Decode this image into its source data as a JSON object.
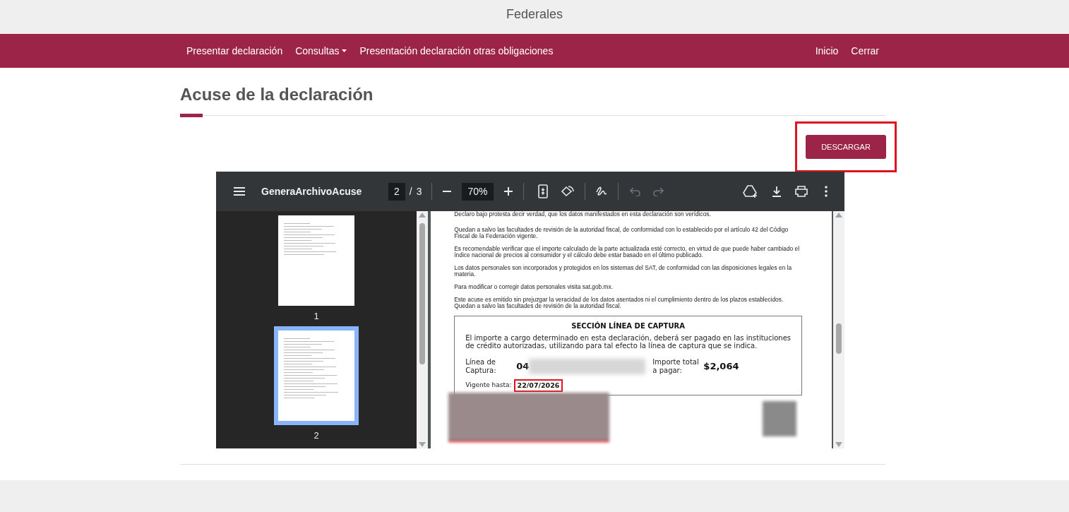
{
  "header": {
    "title": "Federales"
  },
  "nav": {
    "left": [
      {
        "label": "Presentar declaración",
        "kind": "link"
      },
      {
        "label": "Consultas",
        "kind": "dropdown"
      },
      {
        "label": "Presentación declaración otras obligaciones",
        "kind": "link"
      }
    ],
    "right": [
      {
        "label": "Inicio"
      },
      {
        "label": "Cerrar"
      }
    ]
  },
  "page_title": "Acuse de la declaración",
  "download_button": "DESCARGAR",
  "viewer": {
    "file_name": "GeneraArchivoAcuse",
    "page_current": "2",
    "page_separator": "/",
    "page_total": "3",
    "zoom": "70%",
    "thumbnails": [
      {
        "label": "1",
        "selected": false
      },
      {
        "label": "2",
        "selected": true
      }
    ],
    "paragraphs": [
      "Declaro bajo protesta decir verdad, que los datos manifestados en esta declaración son verídicos.",
      "Quedan a salvo las facultades de revisión de la autoridad fiscal, de conformidad con lo establecido por el artículo 42 del Código Fiscal de la Federación vigente.",
      "Es recomendable verificar que el importe calculado de la parte actualizada esté correcto, en virtud de que puede haber cambiado el índice nacional de precios al consumidor y el cálculo debe estar basado en el último publicado.",
      "Los datos personales son incorporados y protegidos en los sistemas del SAT, de conformidad con las disposiciones legales en la materia.",
      "Para modificar o corregir datos personales visita sat.gob.mx.",
      "Este acuse es emitido sin prejuzgar la veracidad de los datos asentados ni el cumplimiento dentro de los plazos establecidos. Quedan a salvo las facultades de revisión de la autoridad fiscal."
    ],
    "section": {
      "title": "SECCIÓN LÍNEA DE CAPTURA",
      "text": "El importe a cargo determinado en esta declaración, deberá ser pagado en las instituciones de crédito autorizadas, utilizando para tal efecto la línea de captura que se indica.",
      "capture_label": "Línea de Captura:",
      "capture_value": "04",
      "total_label": "Importe total a pagar:",
      "total_value": "$2,064",
      "valid_label": "Vigente hasta:",
      "valid_value": "22/07/2026"
    }
  }
}
